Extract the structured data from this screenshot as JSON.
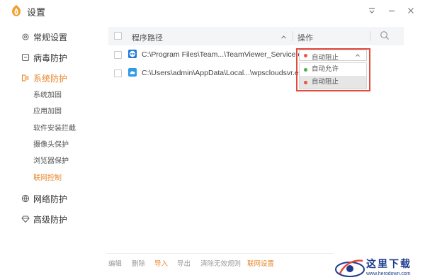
{
  "window": {
    "title": "设置"
  },
  "sidebar": {
    "items": [
      {
        "label": "常规设置",
        "icon": "gear-icon"
      },
      {
        "label": "病毒防护",
        "icon": "virus-scan-icon"
      },
      {
        "label": "系统防护",
        "icon": "system-shield-icon",
        "active": true
      },
      {
        "label": "网络防护",
        "icon": "globe-icon"
      },
      {
        "label": "高级防护",
        "icon": "diamond-icon"
      }
    ],
    "sub_items": [
      {
        "label": "系统加固"
      },
      {
        "label": "应用加固"
      },
      {
        "label": "软件安装拦截"
      },
      {
        "label": "摄像头保护"
      },
      {
        "label": "浏览器保护"
      },
      {
        "label": "联网控制",
        "active": true
      }
    ]
  },
  "table": {
    "headers": {
      "path": "程序路径",
      "action": "操作"
    },
    "rows": [
      {
        "path": "C:\\Program Files\\Team...\\TeamViewer_Service.exe",
        "app_icon": "teamviewer-icon",
        "action": "自动阻止",
        "action_color": "#e8583b"
      },
      {
        "path": "C:\\Users\\admin\\AppData\\Local...\\wpscloudsvr.exe",
        "app_icon": "wps-cloud-icon"
      }
    ]
  },
  "dropdown": {
    "selected": "自动阻止",
    "options": [
      {
        "label": "自动允许",
        "color": "#4cae4c"
      },
      {
        "label": "自动阻止",
        "color": "#e8583b"
      }
    ]
  },
  "footer": {
    "buttons": [
      "编辑",
      "删除",
      "导入",
      "导出",
      "清除无效规则",
      "联网设置"
    ]
  },
  "watermark": {
    "text": "这里下载",
    "url": "www.herodown.com"
  },
  "colors": {
    "accent": "#e8862a",
    "highlight_border": "#e34a3c",
    "allow": "#4cae4c",
    "block": "#e8583b"
  }
}
